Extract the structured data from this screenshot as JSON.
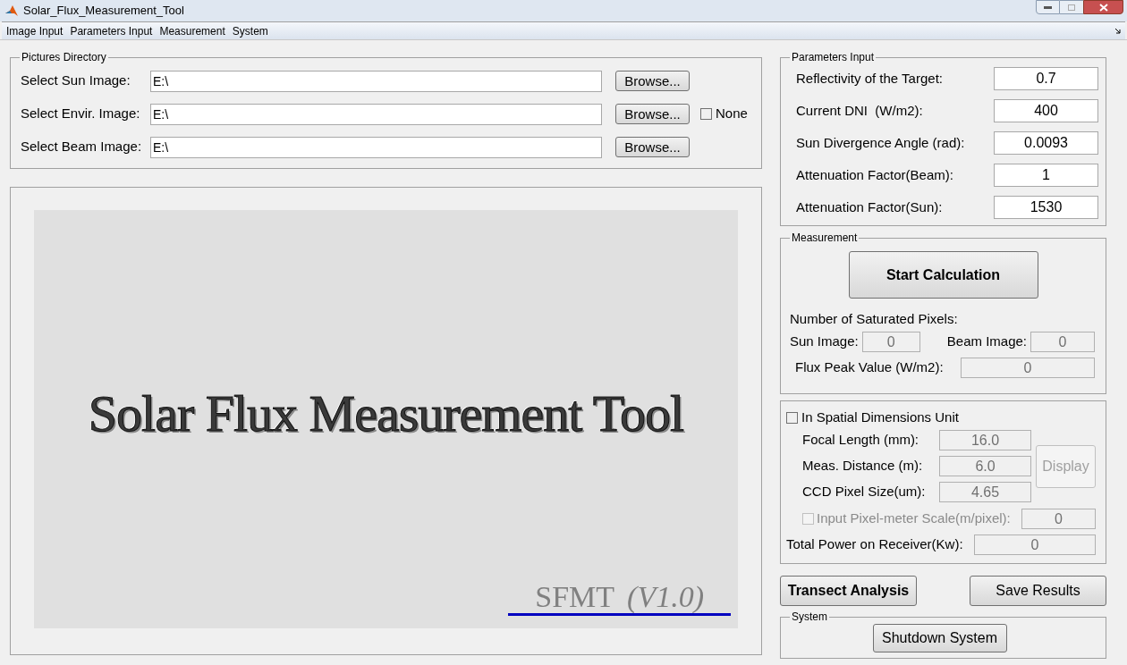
{
  "window": {
    "title": "Solar_Flux_Measurement_Tool"
  },
  "menu": [
    "Image Input",
    "Parameters Input",
    "Measurement",
    "System"
  ],
  "pictures_directory": {
    "title": "Pictures Directory",
    "rows": [
      {
        "label": "Select Sun Image:",
        "value": "E:\\",
        "button": "Browse..."
      },
      {
        "label": "Select Envir. Image:",
        "value": "E:\\",
        "button": "Browse...",
        "checkbox": {
          "label": "None",
          "checked": false
        }
      },
      {
        "label": "Select Beam Image:",
        "value": "E:\\",
        "button": "Browse..."
      }
    ]
  },
  "splash": {
    "title": "Solar Flux Measurement Tool",
    "name": "SFMT",
    "version": "(V1.0)"
  },
  "parameters_input": {
    "title": "Parameters Input",
    "rows": [
      {
        "label": "Reflectivity of the Target:",
        "value": "0.7"
      },
      {
        "label": "Current DNI  (W/m2):",
        "value": "400"
      },
      {
        "label": "Sun Divergence Angle (rad):",
        "value": "0.0093"
      },
      {
        "label": "Attenuation Factor(Beam):",
        "value": "1"
      },
      {
        "label": "Attenuation Factor(Sun):",
        "value": "1530"
      }
    ]
  },
  "measurement": {
    "title": "Measurement",
    "button": "Start Calculation",
    "saturated_label": "Number of Saturated Pixels:",
    "sun_label": "Sun Image:",
    "sun_value": "0",
    "beam_label": "Beam Image:",
    "beam_value": "0",
    "flux_label": "Flux Peak Value (W/m2):",
    "flux_value": "0"
  },
  "spatial": {
    "checkbox": {
      "label": "In Spatial Dimensions Unit",
      "checked": false
    },
    "rows": [
      {
        "label": "Focal Length (mm):",
        "value": "16.0"
      },
      {
        "label": "Meas. Distance (m):",
        "value": "6.0"
      },
      {
        "label": "CCD Pixel Size(um):",
        "value": "4.65"
      }
    ],
    "display_button": {
      "label": "Display",
      "disabled": true
    },
    "scale": {
      "label": "Input Pixel-meter Scale(m/pixel):",
      "value": "0",
      "checked": false,
      "disabled": true
    },
    "power_label": "Total Power on Receiver(Kw):",
    "power_value": "0"
  },
  "actions": [
    {
      "label": "Transect Analysis",
      "bold": true
    },
    {
      "label": "Save Results",
      "bold": false
    }
  ],
  "system": {
    "title": "System",
    "button": "Shutdown System"
  }
}
